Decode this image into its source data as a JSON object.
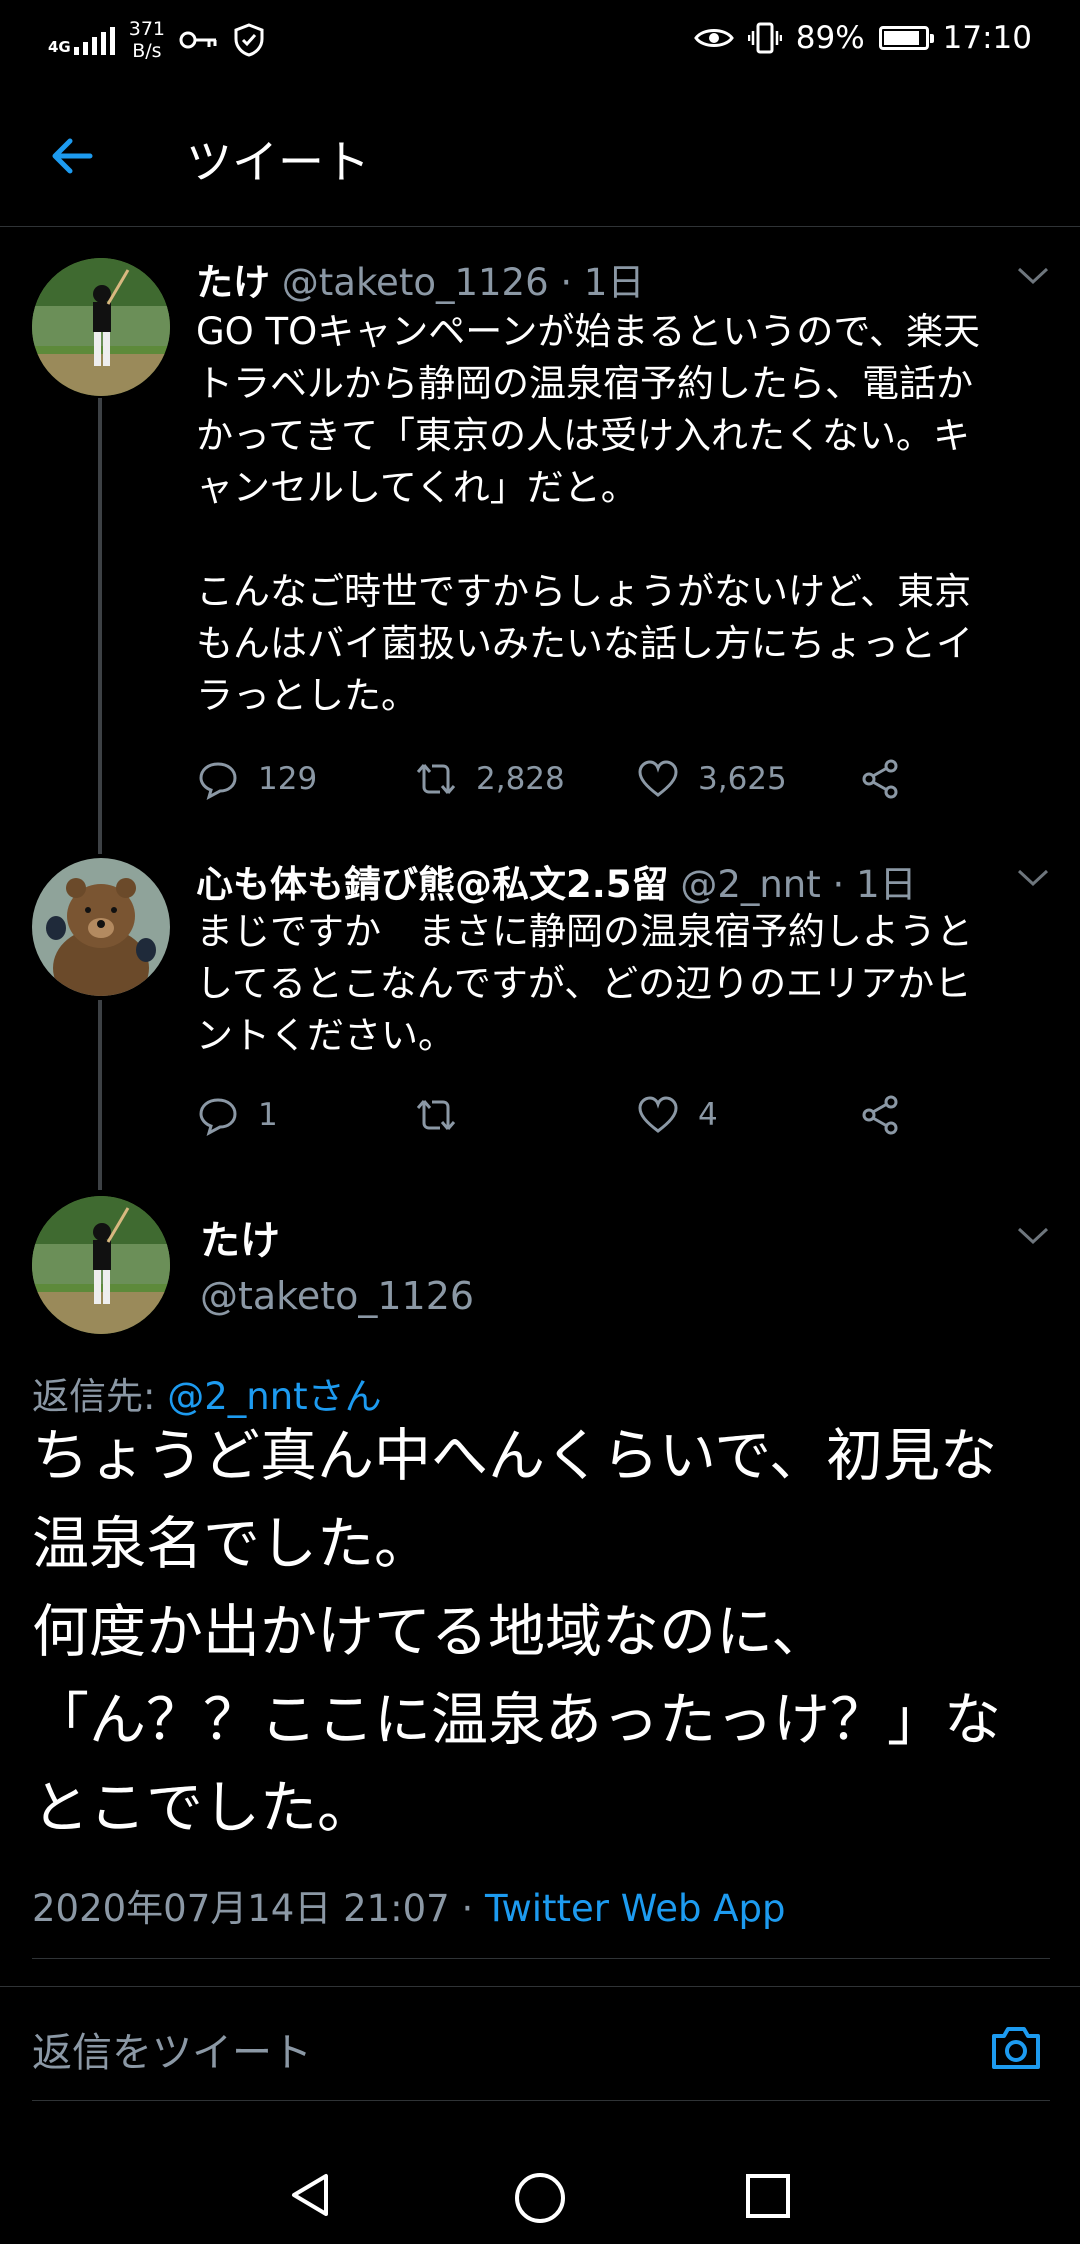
{
  "status_bar": {
    "network": "4G",
    "speed_value": "371",
    "speed_unit": "B/s",
    "battery": "89%",
    "battery_level": 0.89,
    "time": "17:10"
  },
  "header": {
    "title": "ツイート"
  },
  "tweets": [
    {
      "name": "たけ",
      "handle": "@taketo_1126",
      "age": "1日",
      "text": "GO TOキャンペーンが始まるというので、楽天\nトラベルから静岡の温泉宿予約したら、電話か\nかってきて「東京の人は受け入れたくない。キ\nャンセルしてくれ」だと。\n\nこんなご時世ですからしょうがないけど、東京\nもんはバイ菌扱いみたいな話し方にちょっとイ\nラっとした。",
      "replies": "129",
      "retweets": "2,828",
      "likes": "3,625"
    },
    {
      "name": "心も体も錆び熊@私文2.5留",
      "handle": "@2_nnt",
      "age": "1日",
      "text": "まじですか　まさに静岡の温泉宿予約しようと\nしてるとこなんですが、どの辺りのエリアかヒ\nントください。",
      "replies": "1",
      "retweets": "",
      "likes": "4"
    }
  ],
  "main_tweet": {
    "name": "たけ",
    "handle": "@taketo_1126",
    "reply_to_label": "返信先: ",
    "reply_to_link": "@2_nntさん",
    "text": "ちょうど真ん中へんくらいで、初見な\n温泉名でした。\n何度か出かけてる地域なのに、\n「ん？？ここに温泉あったっけ？」な\nとこでした。",
    "timestamp": "2020年07月14日 21:07",
    "separator": " · ",
    "source": "Twitter Web App"
  },
  "reply_bar": {
    "placeholder": "返信をツイート"
  },
  "colors": {
    "accent": "#1d9bf0",
    "muted": "#8b98a5",
    "background": "#000000"
  }
}
